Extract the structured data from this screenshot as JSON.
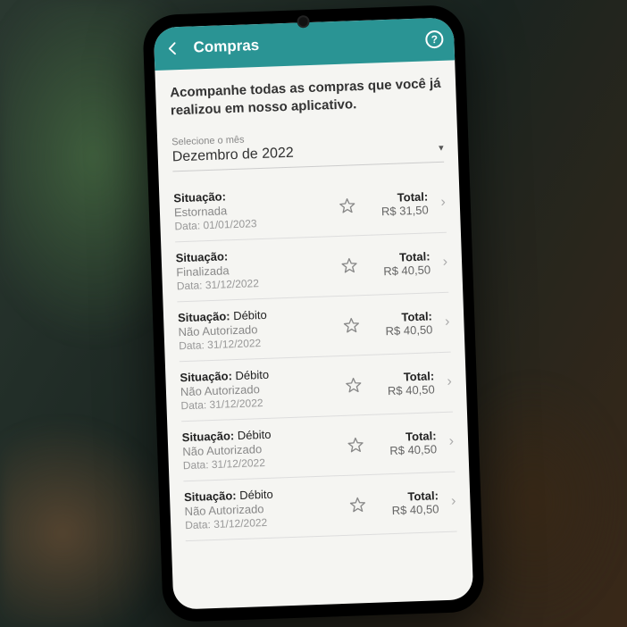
{
  "header": {
    "title": "Compras",
    "help": "?"
  },
  "intro": "Acompanhe todas as compras que você já realizou em nosso aplicativo.",
  "monthSelector": {
    "label": "Selecione o mês",
    "value": "Dezembro de 2022"
  },
  "labels": {
    "situacao": "Situação:",
    "data": "Data:",
    "total": "Total:"
  },
  "items": [
    {
      "status_main": "",
      "status_sub": "Estornada",
      "date": "01/01/2023",
      "total": "R$ 31,50"
    },
    {
      "status_main": "",
      "status_sub": "Finalizada",
      "date": "31/12/2022",
      "total": "R$ 40,50"
    },
    {
      "status_main": "Débito",
      "status_sub": "Não Autorizado",
      "date": "31/12/2022",
      "total": "R$ 40,50"
    },
    {
      "status_main": "Débito",
      "status_sub": "Não Autorizado",
      "date": "31/12/2022",
      "total": "R$ 40,50"
    },
    {
      "status_main": "Débito",
      "status_sub": "Não Autorizado",
      "date": "31/12/2022",
      "total": "R$ 40,50"
    },
    {
      "status_main": "Débito",
      "status_sub": "Não Autorizado",
      "date": "31/12/2022",
      "total": "R$ 40,50"
    }
  ]
}
